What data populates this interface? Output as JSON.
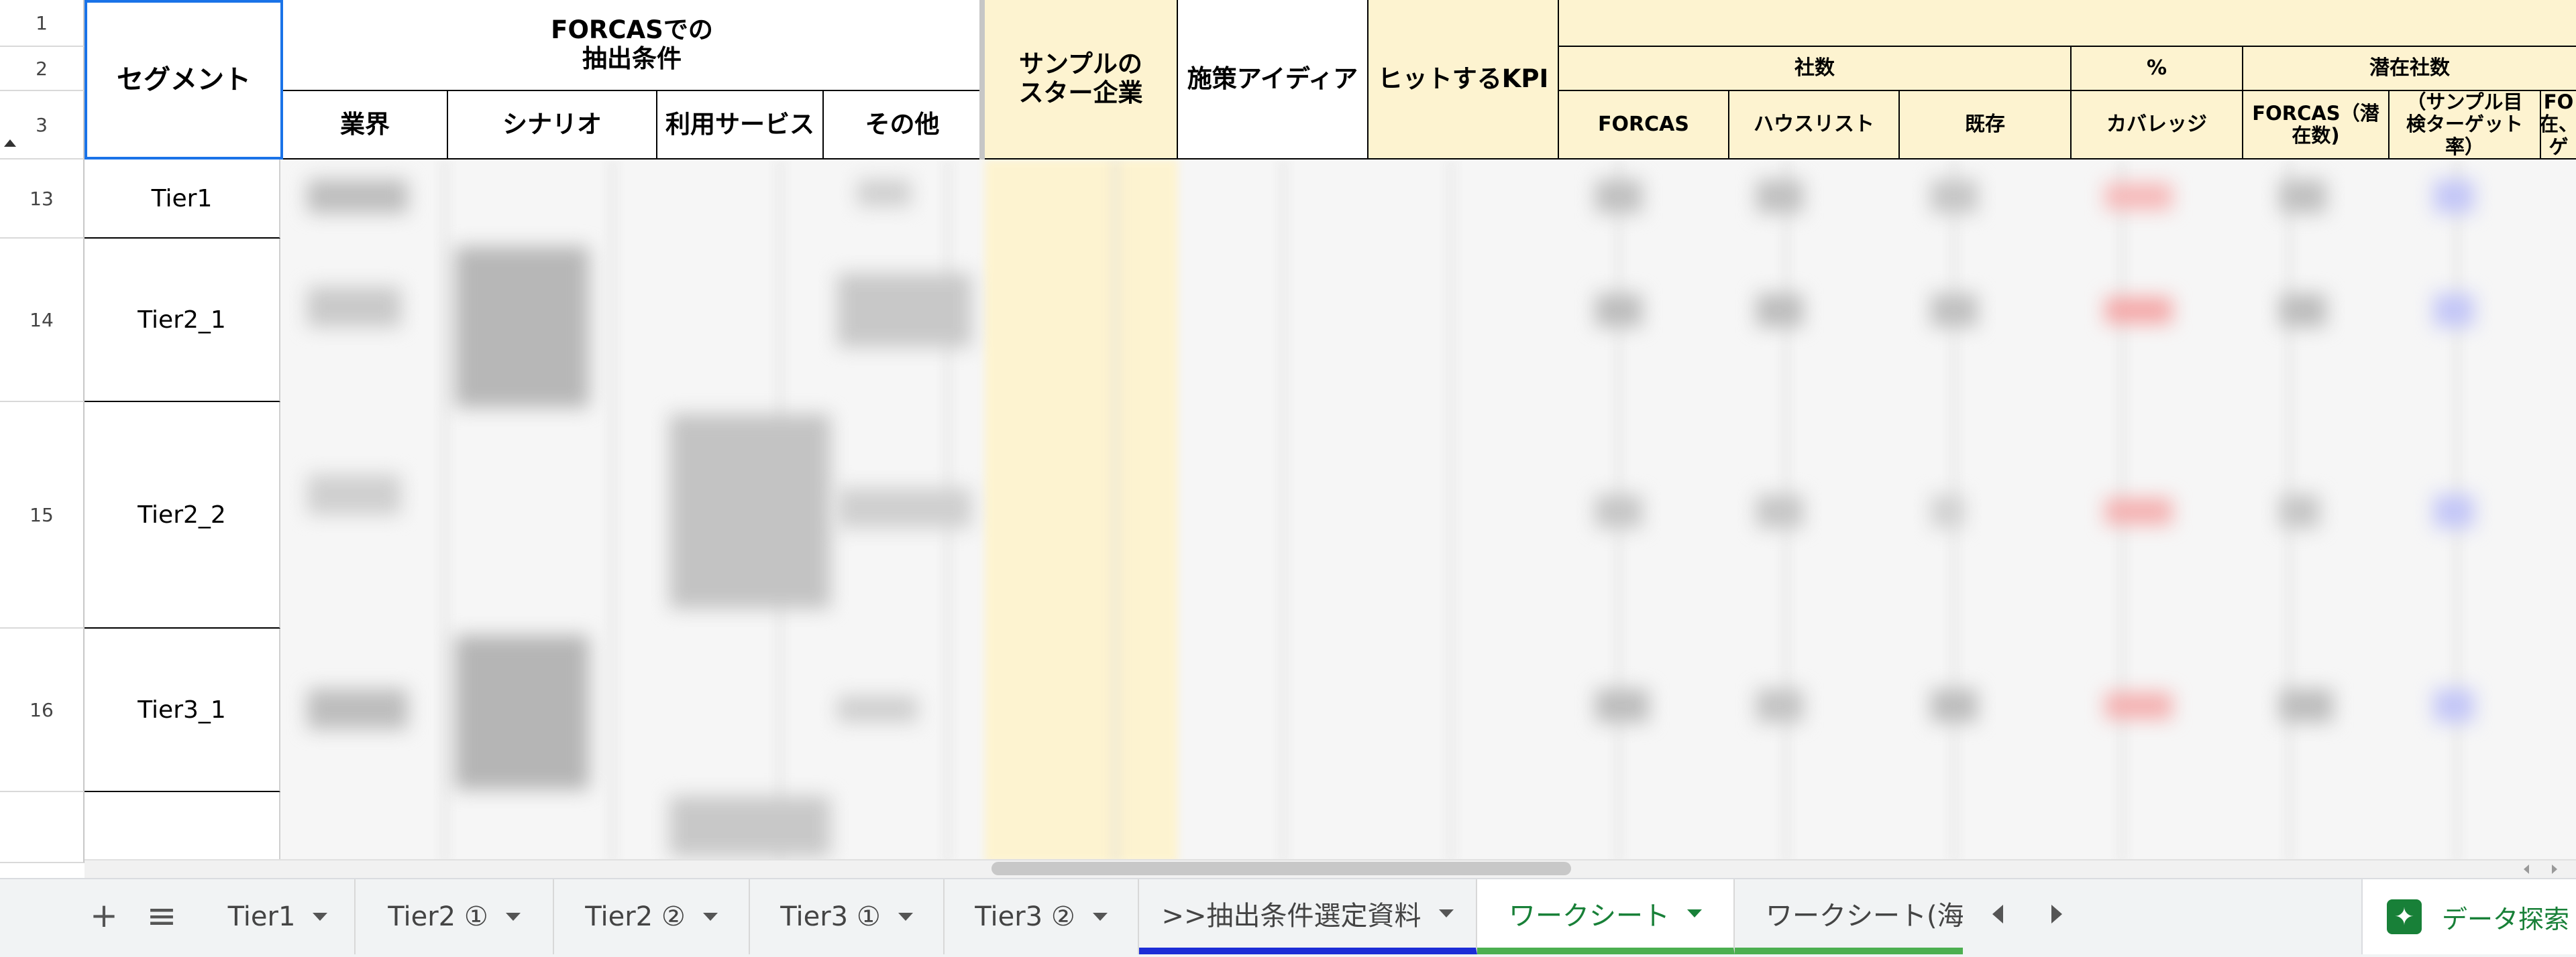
{
  "header": {
    "corner_label": "セグメント",
    "forcas_group_label": "FORCASでの\n抽出条件",
    "forcas_cols": [
      "業界",
      "シナリオ",
      "利用サービス",
      "その他"
    ],
    "sample_star": "サンプルの\nスター企業",
    "strategy_idea": "施策アイディア",
    "hit_kpi": "ヒットするKPI",
    "company_count_group": "社数",
    "company_cols": [
      "FORCAS",
      "ハウスリスト",
      "既存"
    ],
    "pct_group": "%",
    "pct_cols": [
      "カバレッジ"
    ],
    "potential_group": "潜在社数",
    "potential_cols": [
      "FORCAS（潜\n在数)",
      "（サンプル目\n検ターゲット\n率）",
      "FO\n在、\nゲ"
    ]
  },
  "rows": [
    {
      "num": "13",
      "segment": "Tier1"
    },
    {
      "num": "14",
      "segment": "Tier2_1"
    },
    {
      "num": "15",
      "segment": "Tier2_2"
    },
    {
      "num": "16",
      "segment": "Tier3_1"
    }
  ],
  "header_row_nums": [
    "1",
    "2",
    "3"
  ],
  "tabs": {
    "add_icon": "+",
    "list_icon": "≡",
    "items": [
      "Tier1",
      "Tier2 ①",
      "Tier2 ②",
      "Tier3 ①",
      "Tier3 ②",
      ">>抽出条件選定資料",
      "ワークシート",
      "ワークシート(海"
    ],
    "explore_label": "データ探索"
  },
  "colors": {
    "header_yellow": "#fdf3d0",
    "active_tab_green": "#188038",
    "selection_blue": "#1a73e8",
    "tab_underline_blue": "#1c2dd6",
    "tab_underline_green": "#4caf50"
  }
}
